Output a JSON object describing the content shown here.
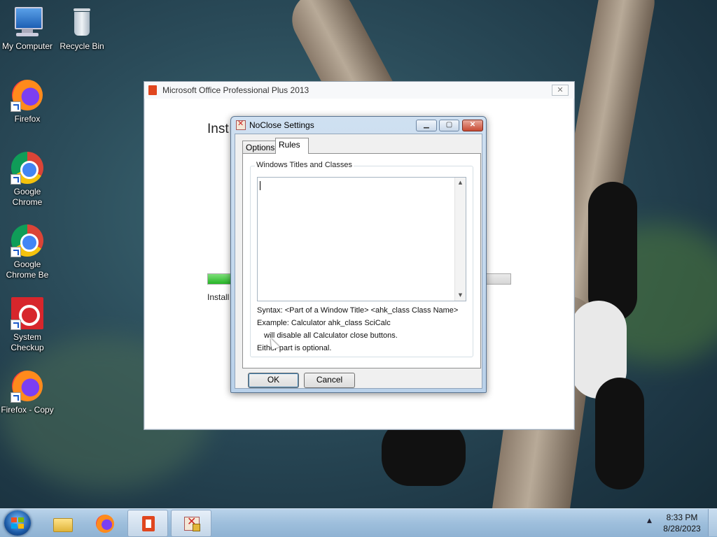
{
  "desktop": {
    "icons": [
      {
        "label": "My Computer",
        "icon": "computer-icon"
      },
      {
        "label": "Recycle Bin",
        "icon": "recycle-bin-icon"
      },
      {
        "label": "Firefox",
        "icon": "firefox-icon"
      },
      {
        "label": "Google Chrome",
        "icon": "chrome-icon"
      },
      {
        "label": "Google Chrome Be",
        "icon": "chrome-icon"
      },
      {
        "label": "System Checkup",
        "icon": "system-checkup-icon"
      },
      {
        "label": "Firefox - Copy",
        "icon": "firefox-icon"
      }
    ]
  },
  "office_window": {
    "title": "Microsoft Office Professional Plus 2013",
    "heading": "Inst",
    "status": "Install",
    "progress": 0.08
  },
  "dialog": {
    "title": "NoClose Settings",
    "tabs": [
      "Options",
      "Rules"
    ],
    "active_tab": "Rules",
    "group_label": "Windows Titles and Classes",
    "rules_value": "",
    "help": {
      "syntax": "Syntax: <Part of a Window Title> <ahk_class Class Name>",
      "example": "Example: Calculator ahk_class SciCalc",
      "example_detail": "will disable all Calculator close buttons.",
      "optional": "Either part is optional."
    },
    "ok_label": "OK",
    "cancel_label": "Cancel"
  },
  "taskbar": {
    "time": "8:33 PM",
    "date": "8/28/2023",
    "pinned": [
      "windows-explorer-icon",
      "firefox-icon",
      "office-icon",
      "noclose-icon"
    ],
    "active_item": "office-icon"
  },
  "colors": {
    "dialog_frame": "#b9d1ea",
    "progress_fill": "#26b426",
    "office_red": "#e0461e"
  }
}
